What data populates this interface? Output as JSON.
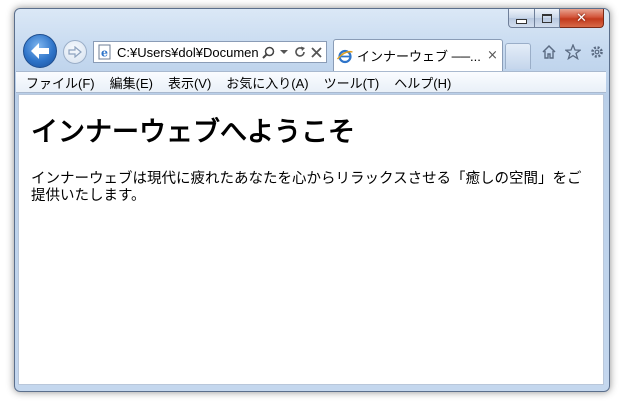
{
  "browser": {
    "address": "C:¥Users¥dol¥Documen",
    "tab_title": "インナーウェブ ──...",
    "tab_close": "×",
    "close_glyph": "✕",
    "icons": {
      "back": "back-arrow-icon",
      "forward": "forward-arrow-icon",
      "page": "ie-page-icon",
      "search": "search-icon",
      "dropdown": "dropdown-icon",
      "refresh": "refresh-icon",
      "stop": "stop-icon",
      "home": "home-icon",
      "favorites": "star-icon",
      "tools": "gear-icon"
    }
  },
  "menu": [
    "ファイル(F)",
    "編集(E)",
    "表示(V)",
    "お気に入り(A)",
    "ツール(T)",
    "ヘルプ(H)"
  ],
  "page": {
    "heading": "インナーウェブへようこそ",
    "paragraph": "インナーウェブは現代に疲れたあなたを心からリラックスさせる「癒しの空間」をご提供いたします。"
  },
  "colors": {
    "frame": "#c7daf0",
    "accent_blue": "#2e74c9",
    "close_red": "#c23a1d"
  }
}
